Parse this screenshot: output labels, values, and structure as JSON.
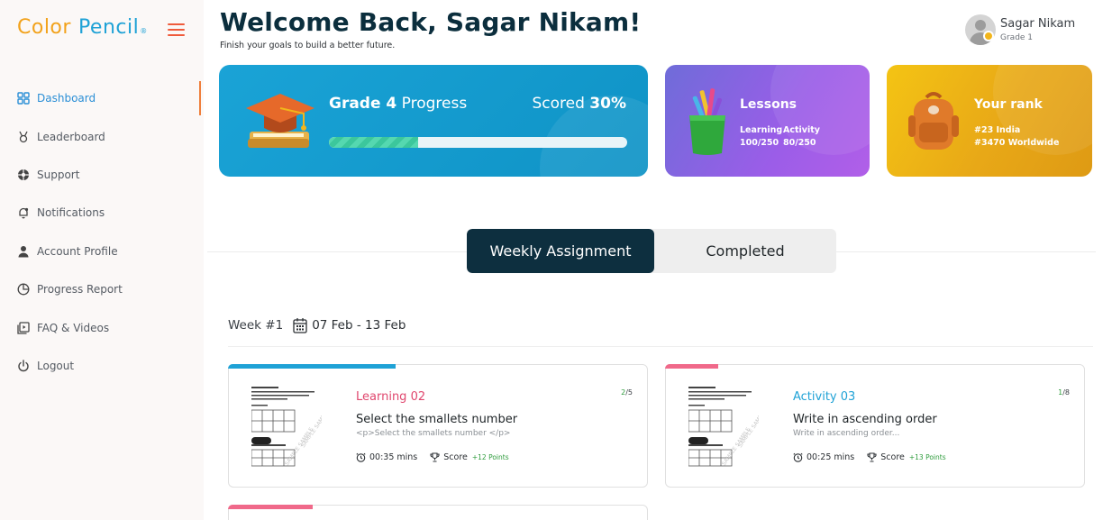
{
  "brand": {
    "logo_part1": "Color",
    "logo_part2": "Pencil",
    "logo_mark": "®"
  },
  "sidebar": {
    "items": [
      {
        "label": "Dashboard",
        "icon": "grid-icon",
        "active": true
      },
      {
        "label": "Leaderboard",
        "icon": "medal-icon"
      },
      {
        "label": "Support",
        "icon": "support-icon"
      },
      {
        "label": "Notifications",
        "icon": "bell-icon"
      },
      {
        "label": "Account Profile",
        "icon": "user-icon"
      },
      {
        "label": "Progress Report",
        "icon": "chart-icon"
      },
      {
        "label": "FAQ & Videos",
        "icon": "video-icon"
      },
      {
        "label": "Logout",
        "icon": "power-icon"
      }
    ]
  },
  "header": {
    "title": "Welcome Back, Sagar Nikam!",
    "subtitle": "Finish your goals to build a better future."
  },
  "user": {
    "name": "Sagar Nikam",
    "grade": "Grade 1"
  },
  "progress_card": {
    "grade_bold": "Grade 4",
    "grade_rest": " Progress",
    "scored_label": "Scored ",
    "scored_value": "30%",
    "fill_fraction": 0.3
  },
  "lessons_card": {
    "title": "Lessons",
    "learning_label": "Learning",
    "activity_label": "Activity",
    "learning_value": "100/250",
    "activity_value": "80/250"
  },
  "rank_card": {
    "title": "Your rank",
    "india": "#23 India",
    "world": "#3470 Worldwide"
  },
  "tabs": {
    "weekly": "Weekly Assignment",
    "completed": "Completed"
  },
  "week": {
    "label": "Week #1",
    "range": "07 Feb - 13 Feb"
  },
  "assignments": [
    {
      "category": "Learning 02",
      "category_color": "#e0476e",
      "accent_color": "#1fa2d6",
      "done": "2",
      "total": "/5",
      "title": "Select the smallets number",
      "desc": "<p>Select the smallets number </p>",
      "time": "00:35 mins",
      "score_label": "Score",
      "points": "+12 Points"
    },
    {
      "category": "Activity 03",
      "category_color": "#1fa2d6",
      "accent_color": "#f0698a",
      "done": "1",
      "total": "/8",
      "title": "Write in ascending order",
      "desc": "Write in ascending order...",
      "time": "00:25 mins",
      "score_label": "Score",
      "points": "+13 Points"
    }
  ]
}
